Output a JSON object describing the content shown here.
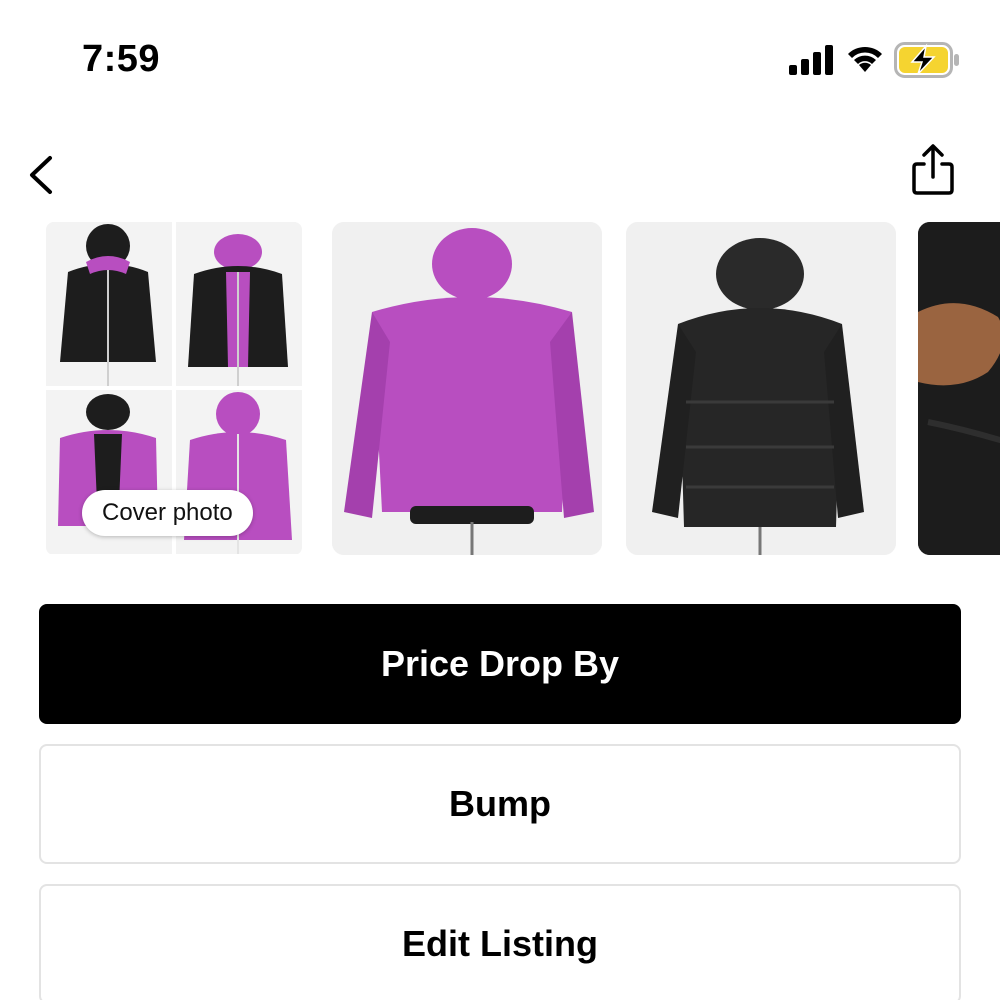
{
  "status_bar": {
    "time": "7:59",
    "icons": [
      "signal-icon",
      "wifi-icon",
      "battery-charging-icon"
    ],
    "battery_color": "#f5d430"
  },
  "nav": {
    "back_icon": "chevron-left-icon",
    "share_icon": "share-icon"
  },
  "photos": {
    "cover_label": "Cover photo",
    "items": [
      {
        "name": "cover-collage",
        "colors": [
          "#1d1d1d",
          "#b84ec0"
        ]
      },
      {
        "name": "purple-jacket-back",
        "colors": [
          "#b84ec0"
        ]
      },
      {
        "name": "black-jacket-back",
        "colors": [
          "#262626"
        ]
      },
      {
        "name": "jacket-detail-hand",
        "colors": [
          "#1c1c1c",
          "#9a6440"
        ]
      }
    ]
  },
  "actions": {
    "price_drop": "Price Drop By",
    "bump": "Bump",
    "edit_listing": "Edit Listing"
  },
  "colors": {
    "primary_button": "#000000",
    "secondary_border": "#e3e3e3"
  }
}
